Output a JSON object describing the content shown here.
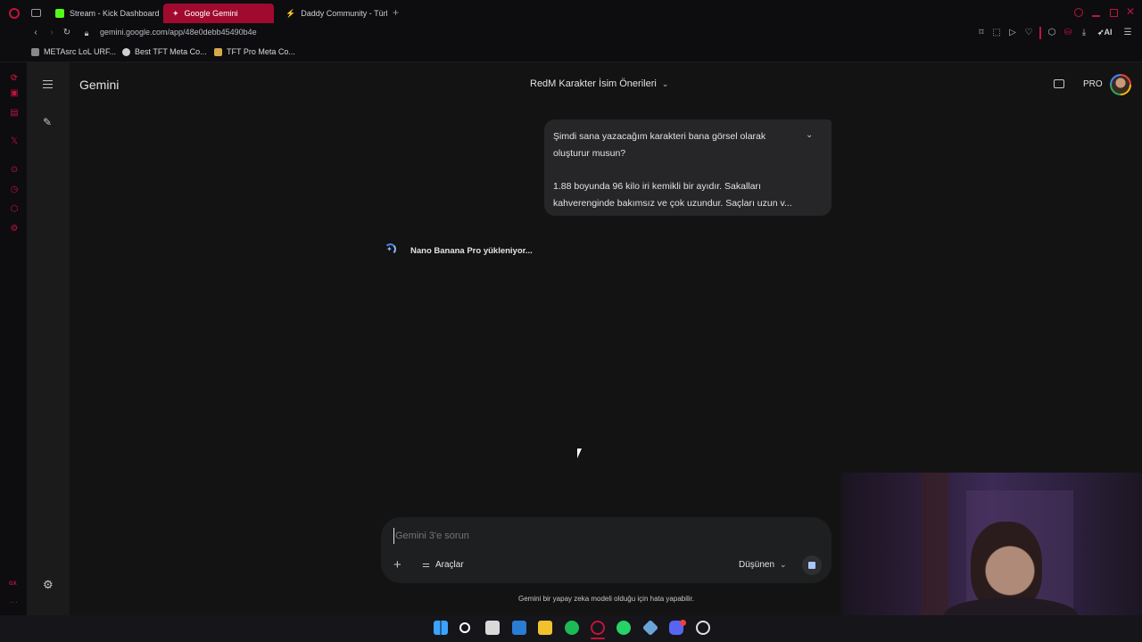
{
  "browser": {
    "tabs": [
      {
        "label": "Stream - Kick Dashboard",
        "active": false,
        "favicon_color": "#53fc18"
      },
      {
        "label": "Google Gemini",
        "active": true,
        "favicon_color": "#ffffff"
      },
      {
        "label": "Daddy Community - Türkiy",
        "active": false,
        "favicon_color": "#cccccc"
      }
    ],
    "url": "gemini.google.com/app/48e0debb45490b4e",
    "bookmarks": [
      {
        "label": "METAsrc LoL URF..."
      },
      {
        "label": "Best TFT Meta Co..."
      },
      {
        "label": "TFT Pro Meta Co..."
      }
    ],
    "ai_label": "AI"
  },
  "gemini": {
    "brand": "Gemini",
    "chat_title": "RedM Karakter İsim Önerileri",
    "pro_label": "PRO",
    "user_message_line1": "Şimdi sana yazacağım karakteri bana görsel olarak",
    "user_message_line2": "oluşturur musun?",
    "user_message_line3": "1.88 boyunda 96 kilo iri kemikli bir ayıdır. Sakalları",
    "user_message_line4": "kahverenginde bakımsız ve çok uzundur. Saçları uzun v...",
    "loading_text": "Nano Banana Pro yükleniyor...",
    "input_placeholder": "Gemini 3'e sorun",
    "tools_label": "Araçlar",
    "mode_label": "Düşünen",
    "disclaimer": "Gemini bir yapay zeka modeli olduğu için hata yapabilir."
  },
  "colors": {
    "accent_red": "#c0143c",
    "active_tab": "#a00a2f",
    "background": "#131314",
    "bubble": "#262628"
  },
  "opera_sidebar": {
    "bottom_label": "GX"
  }
}
